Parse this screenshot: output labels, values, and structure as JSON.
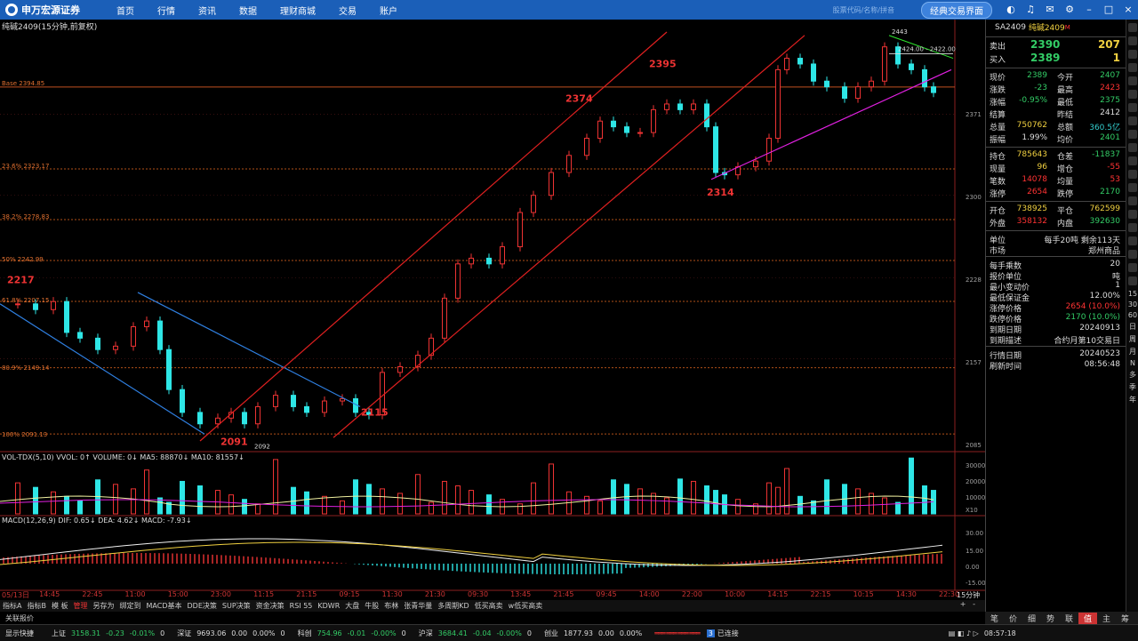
{
  "topbar": {
    "logo_text": "申万宏源证券",
    "nav": [
      "首页",
      "行情",
      "资讯",
      "数据",
      "理财商城",
      "交易",
      "账户"
    ],
    "search_hint": "股票代码/名称/拼音",
    "classic_button": "经典交易界面"
  },
  "chart": {
    "title": "纯碱2409(15分钟,前复权)",
    "base_label": "Base 2394.85",
    "fib_labels": [
      "23.6% 2323.17",
      "38.2% 2278.83",
      "50% 2242.99",
      "61.8% 2207.15",
      "80.9% 2149.14",
      "100% 2091.13"
    ],
    "annotations": [
      "2217",
      "2091",
      "2092",
      "2115",
      "2374",
      "2395",
      "2314",
      "2443",
      "2424.00 - 2422.00"
    ],
    "y_ticks": [
      "2371",
      "2300",
      "2228",
      "2157",
      "2085"
    ],
    "vol_label": "VOL-TDX(5,10) VVOL: 0↑ VOLUME: 0↓ MA5: 88870↓ MA10: 81557↓",
    "vol_ticks": [
      "30000",
      "20000",
      "10000",
      "X10"
    ],
    "macd_label": "MACD(12,26,9) DIF: 0.65↓ DEA: 4.62↓ MACD: -7.93↓",
    "macd_ticks": [
      "30.00",
      "15.00",
      "0.00",
      "-15.00"
    ],
    "time_labels": [
      "05/13日",
      "14:45",
      "22:45",
      "11:00",
      "15:00",
      "23:00",
      "11:15",
      "21:15",
      "09:15",
      "11:30",
      "21:30",
      "09:30",
      "13:45",
      "21:45",
      "09:45",
      "14:00",
      "22:00",
      "10:00",
      "14:15",
      "22:15",
      "10:15",
      "14:30",
      "22:30"
    ],
    "period": "15分钟"
  },
  "chart_data": {
    "type": "candlestick",
    "title": "纯碱2409(15分钟,前复权)",
    "ylim": [
      2085,
      2443
    ],
    "key_levels": {
      "Base": 2394.85,
      "23.6%": 2323.17,
      "38.2%": 2278.83,
      "50%": 2242.99,
      "61.8%": 2207.15,
      "80.9%": 2149.14,
      "100%": 2091.13
    },
    "swing_points": [
      2217,
      2091,
      2115,
      2374,
      2395,
      2314,
      2443
    ],
    "last_price": 2389
  },
  "bottom_tabs": [
    "指标A",
    "指标B",
    "模 板",
    "管理",
    "另存为",
    "绑定到",
    "MACD基本",
    "DDE决策",
    "SUP决策",
    "资金决策",
    "RSI 55",
    "KDWR",
    "大盘",
    "牛股",
    "布林",
    "张青华量",
    "多周期KD",
    "低买高卖",
    "w低买高卖"
  ],
  "bottom_tabs_active": 3,
  "quote_bar_label": "关联报价",
  "right_panel": {
    "head_code": "SA2409",
    "head_name": "纯碱2409",
    "head_tag": "M",
    "sell_label": "卖出",
    "sell_price": "2390",
    "sell_vol": "207",
    "buy_label": "买入",
    "buy_price": "2389",
    "buy_vol": "1",
    "rows1": [
      [
        "现价",
        "2389",
        "今开",
        "2407"
      ],
      [
        "涨跌",
        "-23",
        "最高",
        "2423"
      ],
      [
        "涨幅",
        "-0.95%",
        "最低",
        "2375"
      ],
      [
        "结算",
        "",
        "昨结",
        "2412"
      ],
      [
        "总量",
        "750762",
        "总额",
        "360.5亿"
      ],
      [
        "振幅",
        "1.99%",
        "均价",
        "2401"
      ]
    ],
    "rows2": [
      [
        "持仓",
        "785643",
        "仓差",
        "-11837"
      ],
      [
        "现量",
        "96",
        "增仓",
        "-55"
      ],
      [
        "笔数",
        "14078",
        "均量",
        "53"
      ],
      [
        "涨停",
        "2654",
        "跌停",
        "2170"
      ]
    ],
    "rows3": [
      [
        "开仓",
        "738925",
        "平仓",
        "762599"
      ],
      [
        "外盘",
        "358132",
        "内盘",
        "392630"
      ]
    ],
    "rows4": [
      [
        "单位",
        "每手20吨 剩余113天"
      ],
      [
        "市场",
        "郑州商品"
      ]
    ],
    "rows5": [
      [
        "每手乘数",
        "20"
      ],
      [
        "报价单位",
        "吨"
      ],
      [
        "最小变动价",
        "1"
      ],
      [
        "最低保证金",
        "12.00%"
      ],
      [
        "涨停价格",
        "2654 (10.0%)"
      ],
      [
        "跌停价格",
        "2170 (10.0%)"
      ],
      [
        "到期日期",
        "20240913"
      ],
      [
        "到期描述",
        "合约月第10交易日"
      ]
    ],
    "rows6": [
      [
        "行情日期",
        "20240523"
      ],
      [
        "刷新时间",
        "08:56:48"
      ]
    ]
  },
  "sidebar_text": [
    "15",
    "30",
    "60",
    "日",
    "周",
    "月",
    "N",
    "多",
    "季",
    "年"
  ],
  "rp_tabs": [
    "笔",
    "价",
    "细",
    "势",
    "联",
    "值",
    "主",
    "筹"
  ],
  "rp_tabs_active": 5,
  "status": {
    "show": "显示快捷",
    "sh_name": "上证",
    "sh_val": "3158.31",
    "sh_chg": "-0.23",
    "sh_pct": "-0.01%",
    "sh_vol": "0",
    "sz_name": "深证",
    "sz_val": "9693.06",
    "sz_chg": "0.00",
    "sz_pct": "0.00%",
    "sz_vol": "0",
    "kc_name": "科创",
    "kc_val": "754.96",
    "kc_chg": "-0.01",
    "kc_pct": "-0.00%",
    "kc_vol": "0",
    "hs_name": "沪深",
    "hs_val": "3684.41",
    "hs_chg": "-0.04",
    "hs_pct": "-0.00%",
    "hs_vol": "0",
    "cy_name": "创业",
    "cy_val": "1877.93",
    "cy_chg": "0.00",
    "cy_pct": "0.00%",
    "conn": "已连接",
    "time": "08:57:18"
  }
}
